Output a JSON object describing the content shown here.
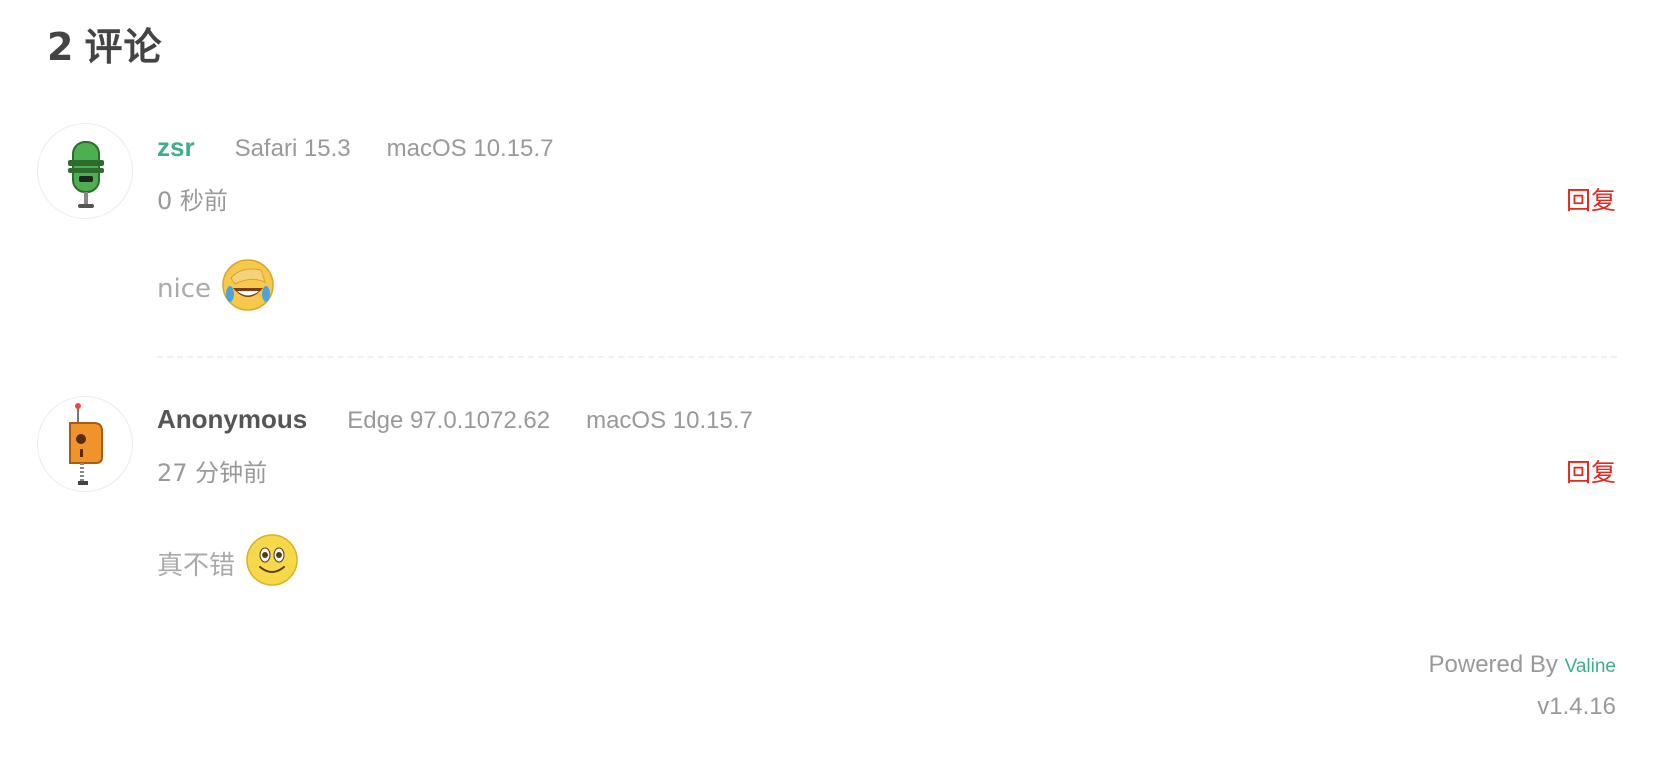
{
  "header": {
    "count": "2",
    "label": "评论"
  },
  "comments": [
    {
      "nick": "zsr",
      "nick_is_link": true,
      "browser": "Safari 15.3",
      "os": "macOS 10.15.7",
      "time": "0 秒前",
      "reply_label": "回复",
      "text": "nice",
      "emoji": "laughing-crying-emoji",
      "avatar": "green-robot-avatar"
    },
    {
      "nick": "Anonymous",
      "nick_is_link": false,
      "browser": "Edge 97.0.1072.62",
      "os": "macOS 10.15.7",
      "time": "27 分钟前",
      "reply_label": "回复",
      "text": "真不错",
      "emoji": "smile-emoji",
      "avatar": "orange-robot-avatar"
    }
  ],
  "footer": {
    "powered_by": "Powered By",
    "brand": "Valine",
    "version": "v1.4.16"
  },
  "colors": {
    "link": "#3fae88",
    "reply": "#e0291c",
    "muted": "#999999"
  }
}
